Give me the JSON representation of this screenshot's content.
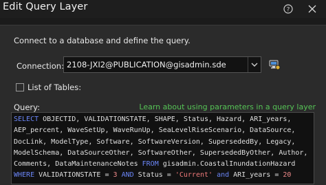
{
  "window": {
    "title": "Edit Query Layer",
    "icons": {
      "help": "help-icon",
      "close": "close-icon"
    }
  },
  "intro_text": "Connect to a database and define the query.",
  "connection": {
    "label": "Connection:",
    "value": "2108-JXI2@PUBLICATION@gisadmin.sde",
    "dropdown_icon": "chevron-down-icon",
    "properties_icon": "connection-properties-icon"
  },
  "list_of_tables": {
    "label": "List of Tables:",
    "checked": false
  },
  "query": {
    "label": "Query:",
    "help_link": "Learn about using parameters in a query layer",
    "lines": [
      [
        {
          "t": "SELECT",
          "c": "kw"
        },
        {
          "t": " OBJECTID, VALIDATIONSTATE, SHAPE, Status, Hazard, ARI_years,"
        }
      ],
      [
        {
          "t": "AEP_percent, WaveSetUp, WaveRunUp, SeaLevelRiseScenario, DataSource,"
        }
      ],
      [
        {
          "t": "DocLink, ModelType, Software, SoftwareVersion, SupersededBy, Legacy,"
        }
      ],
      [
        {
          "t": "ModelSchema, DataSourceOther, SoftwareOther, SupersededByOther, Author,"
        }
      ],
      [
        {
          "t": "Comments, DataMaintenanceNotes "
        },
        {
          "t": "FROM",
          "c": "kw"
        },
        {
          "t": " gisadmin.CoastalInundationHazard"
        }
      ],
      [
        {
          "t": "WHERE",
          "c": "kw"
        },
        {
          "t": " VALIDATIONSTATE = "
        },
        {
          "t": "3",
          "c": "num"
        },
        {
          "t": " "
        },
        {
          "t": "AND",
          "c": "kw"
        },
        {
          "t": " Status = "
        },
        {
          "t": "'Current'",
          "c": "str"
        },
        {
          "t": " "
        },
        {
          "t": "and",
          "c": "kw"
        },
        {
          "t": " ARI_years = "
        },
        {
          "t": "20",
          "c": "num"
        }
      ]
    ]
  }
}
